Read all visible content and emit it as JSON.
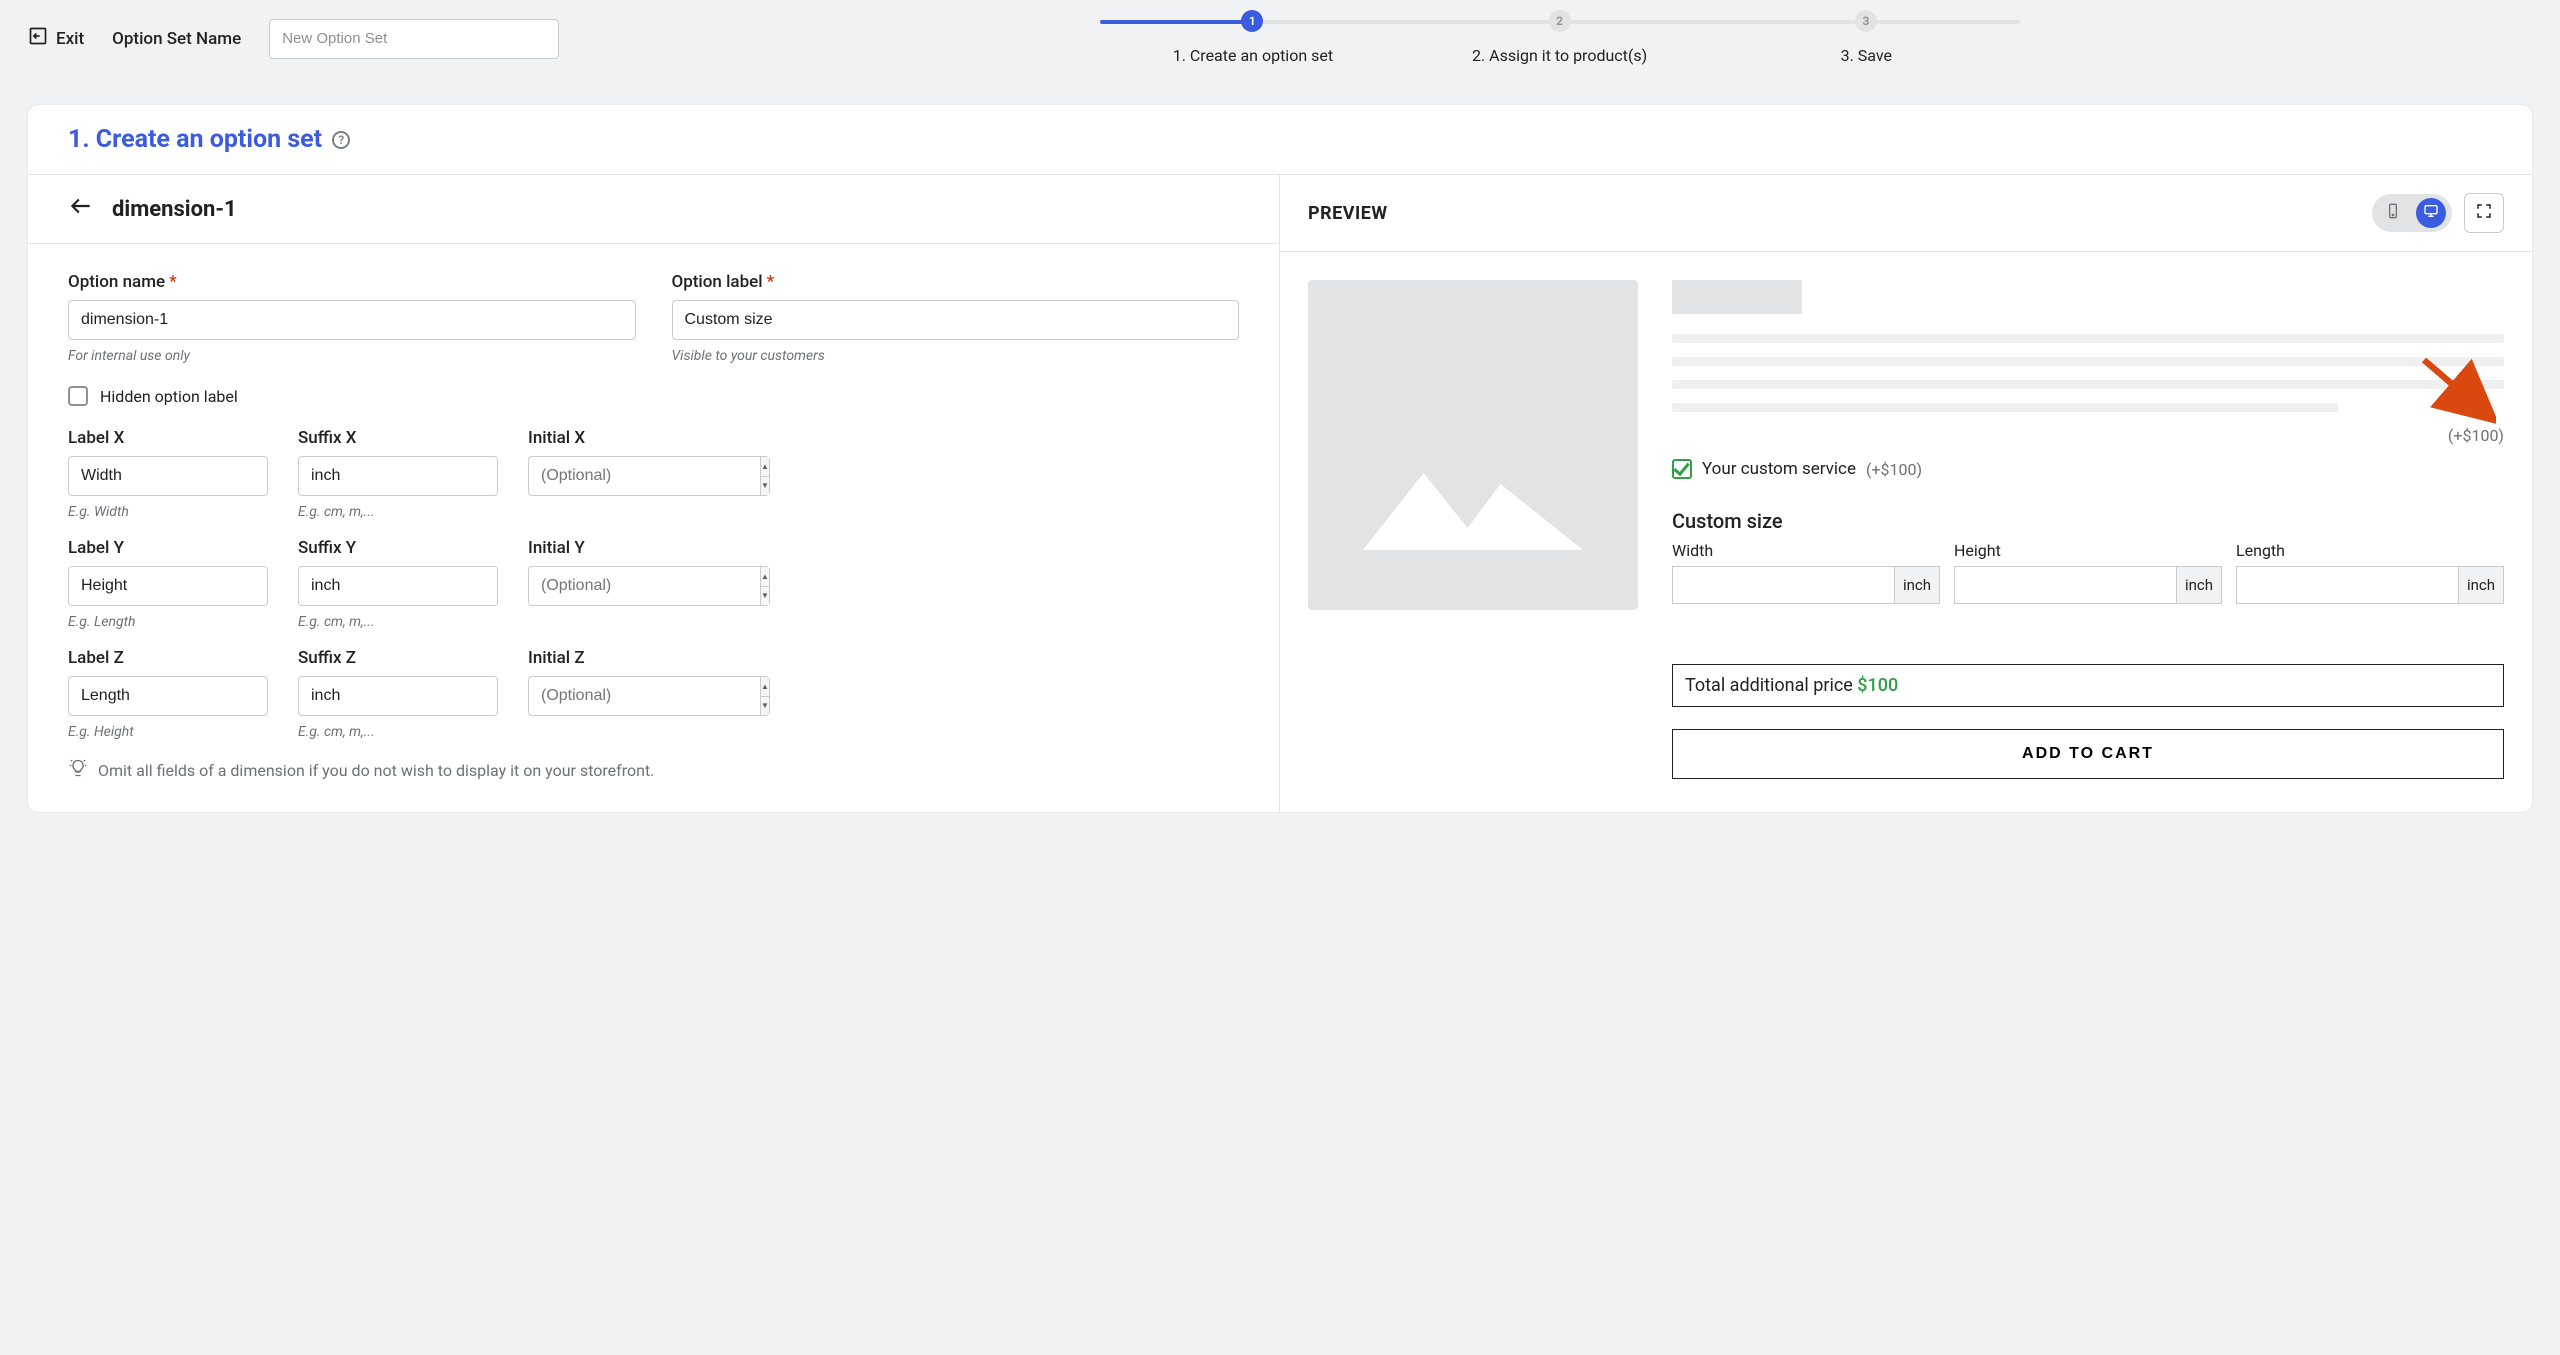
{
  "top": {
    "exit": "Exit",
    "set_name_label": "Option Set Name",
    "set_name_placeholder": "New Option Set"
  },
  "steps": {
    "n1": "1",
    "n2": "2",
    "n3": "3",
    "s1": "1. Create an option set",
    "s2": "2. Assign it to product(s)",
    "s3": "3. Save"
  },
  "card": {
    "title": "1. Create an option set",
    "help": "?"
  },
  "left": {
    "header": "dimension-1",
    "option_name_label": "Option name",
    "option_name_value": "dimension-1",
    "option_name_hint": "For internal use only",
    "option_label_label": "Option label",
    "option_label_value": "Custom size",
    "option_label_hint": "Visible to your customers",
    "hidden_option_label": "Hidden option label",
    "labelx": "Label X",
    "labelx_val": "Width",
    "labelx_hint": "E.g. Width",
    "suffixx": "Suffix X",
    "suffixx_val": "inch",
    "suffixx_hint": "E.g. cm, m,...",
    "initialx": "Initial X",
    "initialx_ph": "(Optional)",
    "labely": "Label Y",
    "labely_val": "Height",
    "labely_hint": "E.g. Length",
    "suffixy": "Suffix Y",
    "suffixy_val": "inch",
    "suffixy_hint": "E.g. cm, m,...",
    "initialy": "Initial Y",
    "initialy_ph": "(Optional)",
    "labelz": "Label Z",
    "labelz_val": "Length",
    "labelz_hint": "E.g. Height",
    "suffixz": "Suffix Z",
    "suffixz_val": "inch",
    "suffixz_hint": "E.g. cm, m,...",
    "initialz": "Initial Z",
    "initialz_ph": "(Optional)",
    "tip": "Omit all fields of a dimension if you do not wish to display it on your storefront."
  },
  "right": {
    "title": "PREVIEW",
    "price_delta": "(+$100)",
    "service_label": "Your custom service",
    "service_price": "(+$100)",
    "custom_size_title": "Custom size",
    "dim_w": "Width",
    "dim_w_unit": "inch",
    "dim_h": "Height",
    "dim_h_unit": "inch",
    "dim_l": "Length",
    "dim_l_unit": "inch",
    "total_label": "Total additional price ",
    "total_amt": "$100",
    "atc": "ADD TO CART"
  }
}
